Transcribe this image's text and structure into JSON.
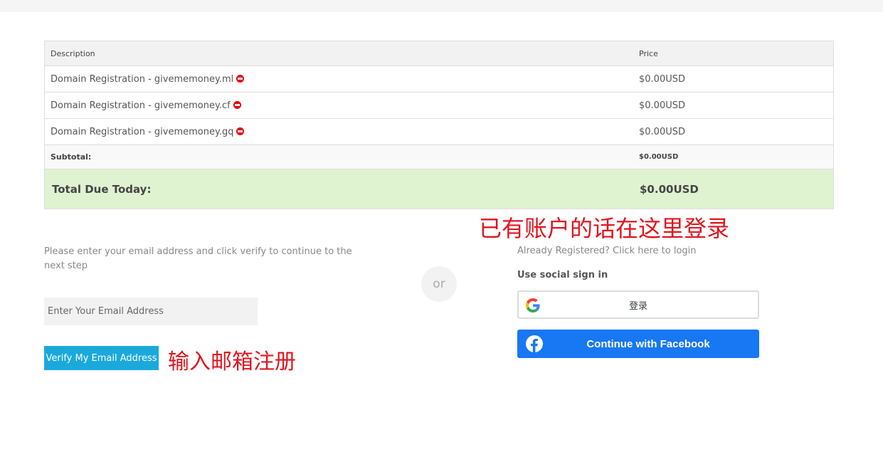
{
  "cart": {
    "headers": {
      "description": "Description",
      "price": "Price"
    },
    "items": [
      {
        "description": "Domain Registration - givememoney.ml",
        "price": "$0.00USD"
      },
      {
        "description": "Domain Registration - givememoney.cf",
        "price": "$0.00USD"
      },
      {
        "description": "Domain Registration - givememoney.gq",
        "price": "$0.00USD"
      }
    ],
    "subtotal": {
      "label": "Subtotal:",
      "value": "$0.00USD"
    },
    "total": {
      "label": "Total Due Today:",
      "value": "$0.00USD"
    }
  },
  "annotations": {
    "login_hint": "已有账户的话在这里登录",
    "register_hint": "输入邮箱注册"
  },
  "register": {
    "instructions": "Please enter your email address and click verify to continue to the next step",
    "email_placeholder": "Enter Your Email Address",
    "verify_label": "Verify My Email Address"
  },
  "divider": {
    "or_label": "or"
  },
  "login": {
    "link_text": "Already Registered? Click here to login",
    "social_title": "Use social sign in",
    "google_label": "登录",
    "facebook_label": "Continue with Facebook"
  },
  "colors": {
    "accent": "#1ba9dc",
    "facebook": "#1877f2",
    "total_bg": "#dff3d1",
    "annotation": "#e0141e",
    "remove": "#e8000c"
  },
  "icons": [
    "remove-icon",
    "google-icon",
    "facebook-icon"
  ]
}
